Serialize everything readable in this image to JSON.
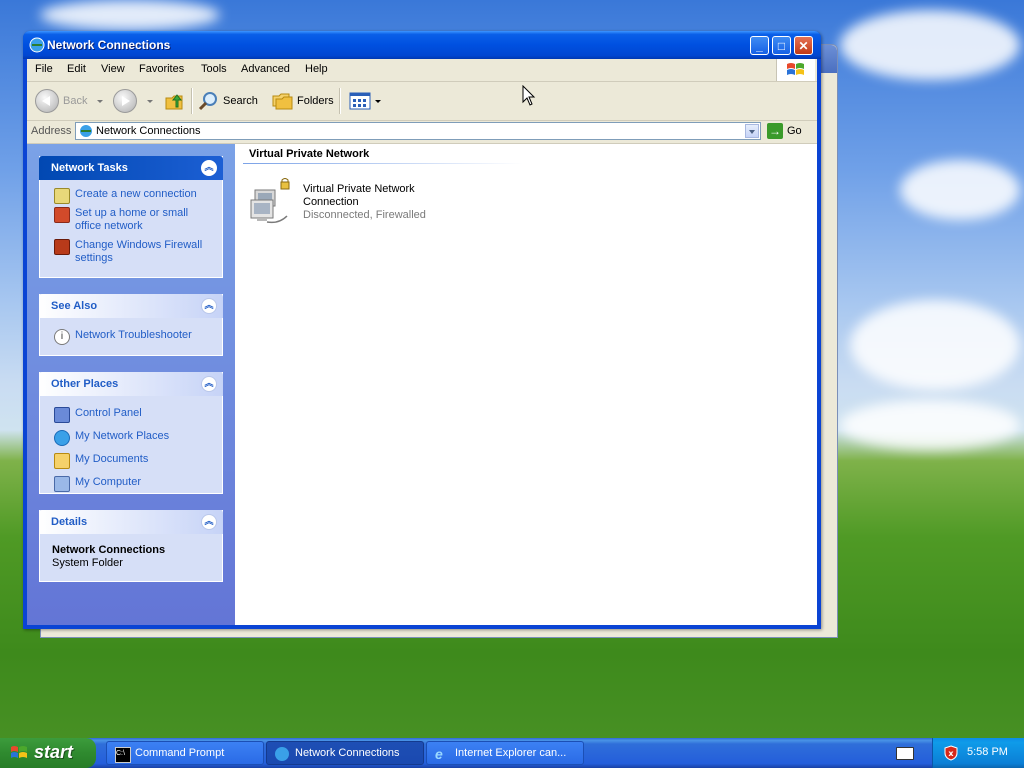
{
  "window": {
    "title": "Network Connections",
    "controls": {
      "minimize": "_",
      "maximize": "□",
      "close": "✕"
    }
  },
  "menubar": {
    "items": [
      "File",
      "Edit",
      "View",
      "Favorites",
      "Tools",
      "Advanced",
      "Help"
    ]
  },
  "toolbar": {
    "back_label": "Back",
    "search_label": "Search",
    "folders_label": "Folders"
  },
  "address": {
    "label": "Address",
    "value": "Network Connections",
    "go_label": "Go"
  },
  "sidebar": {
    "network_tasks": {
      "title": "Network Tasks",
      "items": [
        "Create a new connection",
        "Set up a home or small office network",
        "Change Windows Firewall settings"
      ]
    },
    "see_also": {
      "title": "See Also",
      "items": [
        "Network Troubleshooter"
      ]
    },
    "other_places": {
      "title": "Other Places",
      "items": [
        "Control Panel",
        "My Network Places",
        "My Documents",
        "My Computer"
      ]
    },
    "details": {
      "title": "Details",
      "name": "Network Connections",
      "type": "System Folder"
    }
  },
  "content": {
    "group_header": "Virtual Private Network",
    "connection": {
      "name": "Virtual Private Network Connection",
      "status": "Disconnected, Firewalled"
    }
  },
  "taskbar": {
    "start_label": "start",
    "tasks": [
      "Command Prompt",
      "Network Connections",
      "Internet Explorer can..."
    ],
    "clock": "5:58 PM"
  },
  "colors": {
    "titlebar": "#0050e0",
    "sidebar_link": "#215dc6",
    "taskbar": "#245edb",
    "start_button": "#2f8a2f"
  }
}
